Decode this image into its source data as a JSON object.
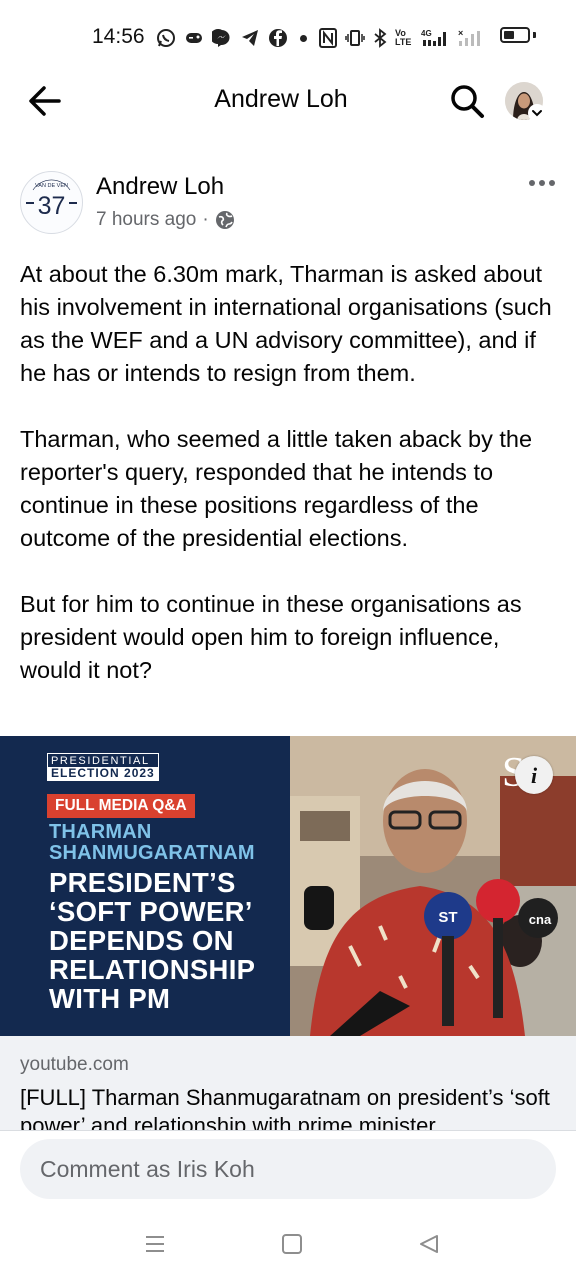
{
  "status_bar": {
    "time": "14:56",
    "net_label_volte": "Vo\nLTE",
    "net_label_4g": "4G"
  },
  "header": {
    "title": "Andrew Loh",
    "back_icon": "arrow-left-icon",
    "search_icon": "search-icon"
  },
  "post": {
    "author": "Andrew Loh",
    "avatar_number": "37",
    "avatar_arc_text": "VAN DE VEN",
    "time_ago": "7 hours ago",
    "separator": "·",
    "audience_icon": "globe-icon",
    "paragraphs": [
      "At about the 6.30m mark, Tharman is asked about his involvement in international organisations (such as the WEF and a UN advisory committee), and if he has or intends to resign from them.",
      "Tharman, who seemed a little taken aback by the reporter's query, responded that he intends to continue in these positions regardless of the outcome of the presidential elections.",
      "But for him to continue in these organisations as president would open him to foreign influence, would it not?"
    ]
  },
  "link_preview": {
    "thumb": {
      "badge_line1": "PRESIDENTIAL",
      "badge_line2": "ELECTION",
      "badge_year": "2023",
      "media_label": "FULL MEDIA Q&A",
      "name_line1": "THARMAN",
      "name_line2": "SHANMUGARATNAM",
      "headline": [
        "PRESIDENT’S",
        "‘SOFT POWER’",
        "DEPENDS ON",
        "RELATIONSHIP",
        "WITH PM"
      ],
      "st_logo": "S",
      "mic_st": "ST",
      "mic_cna": "cna",
      "info_label": "i"
    },
    "domain": "youtube.com",
    "title": "[FULL] Tharman Shanmugaratnam on president’s ‘soft power’ and relationship with prime minister"
  },
  "comment_bar": {
    "placeholder": "Comment as Iris Koh"
  },
  "battery_level": 0.45,
  "colors": {
    "thumb_navy": "#13294f",
    "badge_red": "#d9412f",
    "name_blue": "#7fc2e8",
    "meta_grey": "#65676b",
    "preview_bg": "#f0f2f5"
  }
}
